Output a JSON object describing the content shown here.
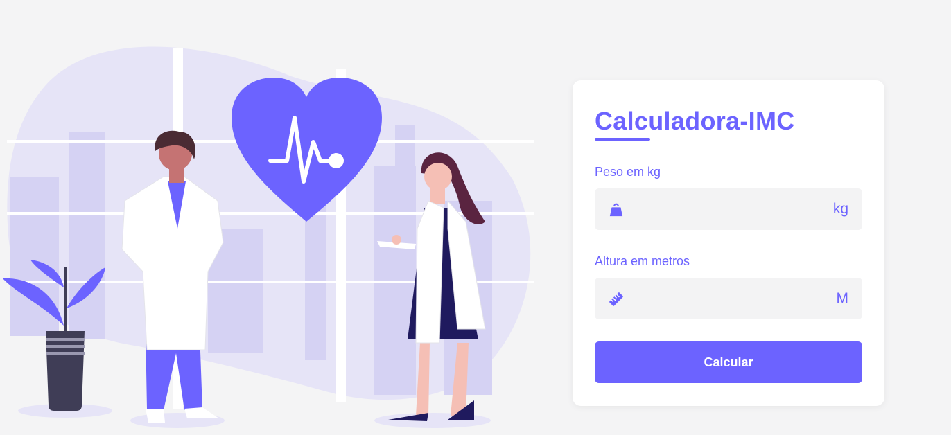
{
  "calculator": {
    "title": "Calculadora-IMC",
    "weight": {
      "label": "Peso em kg",
      "value": "",
      "unit": "kg",
      "icon": "weight-icon"
    },
    "height": {
      "label": "Altura em metros",
      "value": "",
      "unit": "M",
      "icon": "ruler-icon"
    },
    "submit_label": "Calcular"
  },
  "colors": {
    "accent": "#6c63ff",
    "background": "#f4f4f5",
    "card": "#ffffff",
    "field": "#f3f3f4"
  }
}
